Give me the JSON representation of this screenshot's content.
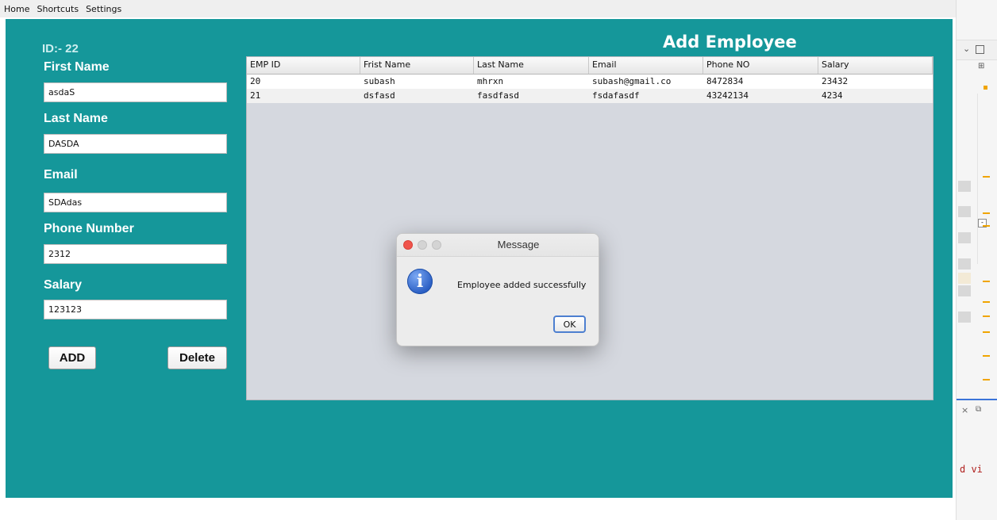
{
  "menu": [
    "Home",
    "Shortcuts",
    "Settings"
  ],
  "form": {
    "id_label": "ID:- 22",
    "first_name_label": "First Name",
    "first_name_value": "asdaS",
    "last_name_label": "Last Name",
    "last_name_value": "DASDA",
    "email_label": "Email",
    "email_value": "SDAdas",
    "phone_label": "Phone Number",
    "phone_value": "2312",
    "salary_label": "Salary",
    "salary_value": "123123",
    "add_button": "ADD",
    "delete_button": "Delete"
  },
  "title": "Add Employee",
  "table": {
    "headers": [
      "EMP ID",
      "Frist Name",
      "Last Name",
      "Email",
      "Phone NO",
      "Salary"
    ],
    "rows": [
      [
        "20",
        "subash",
        "mhrxn",
        "subash@gmail.co",
        "8472834",
        "23432"
      ],
      [
        "21",
        "dsfasd",
        "fasdfasd",
        "fsdafasdf",
        "43242134",
        "4234"
      ]
    ]
  },
  "dialog": {
    "title": "Message",
    "message": "Employee added successfully",
    "ok": "OK"
  },
  "ide": {
    "code_snippet": "d vi"
  },
  "colors": {
    "frame": "#15979a",
    "accent": "#4d7fd0"
  }
}
